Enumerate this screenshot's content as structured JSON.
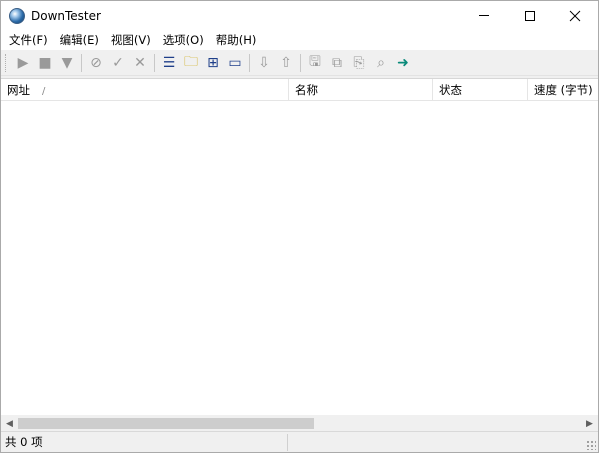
{
  "window": {
    "title": "DownTester"
  },
  "menu": [
    {
      "label": "文件(F)"
    },
    {
      "label": "编辑(E)"
    },
    {
      "label": "视图(V)"
    },
    {
      "label": "选项(O)"
    },
    {
      "label": "帮助(H)"
    }
  ],
  "toolbar": {
    "play_glyph": "▶",
    "stop_glyph": "■",
    "filter_glyph": "▼",
    "ban_glyph": "⊘",
    "check_glyph": "✓",
    "cross_glyph": "✕",
    "list_glyph": "☰",
    "folder_glyph": "🗀",
    "add_glyph": "⊞",
    "window_glyph": "▭",
    "down_glyph": "⇩",
    "up_glyph": "⇧",
    "save_glyph": "🖫",
    "copy_glyph": "⧉",
    "paste_glyph": "⎘",
    "search_glyph": "⌕",
    "exit_glyph": "➜"
  },
  "table": {
    "columns": [
      {
        "label": "网址",
        "sort_indicator": "/"
      },
      {
        "label": "名称"
      },
      {
        "label": "状态"
      },
      {
        "label": "速度 (字节)"
      }
    ],
    "rows": []
  },
  "status": {
    "text": "共 0 项"
  }
}
